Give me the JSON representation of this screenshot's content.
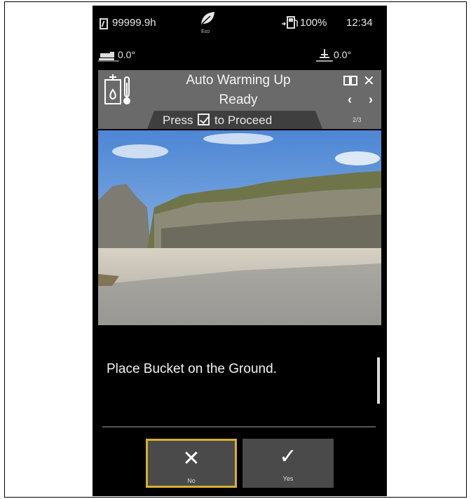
{
  "status": {
    "hour_meter": "99999.9h",
    "eco_label": "Eco",
    "fuel_level": "100%",
    "clock": "12:34"
  },
  "inclination": {
    "machine_angle": "0.0°",
    "tilt_angle": "0.0°"
  },
  "guide": {
    "title": "Auto Warming Up",
    "status": "Ready",
    "proceed_prefix": "Press",
    "proceed_suffix": "to Proceed",
    "page_indicator": "2/3"
  },
  "message": "Place Bucket on the Ground.",
  "buttons": {
    "no_label": "No",
    "yes_label": "Yes"
  },
  "colors": {
    "screen_bg": "#000000",
    "header_bg": "#6a6a6a",
    "selected_outline": "#d6b032",
    "button_bg": "#4a4a4a"
  },
  "icons": {
    "hour_meter": "hour-meter-icon",
    "eco": "leaf-icon",
    "fuel": "fuel-pump-icon",
    "machine": "excavator-icon",
    "tilt": "tilt-icon",
    "guide": "coolant-temperature-icon",
    "manual": "book-icon",
    "close": "close-icon",
    "prev": "chevron-left-icon",
    "next": "chevron-right-icon",
    "no": "x-icon",
    "yes": "check-icon"
  }
}
